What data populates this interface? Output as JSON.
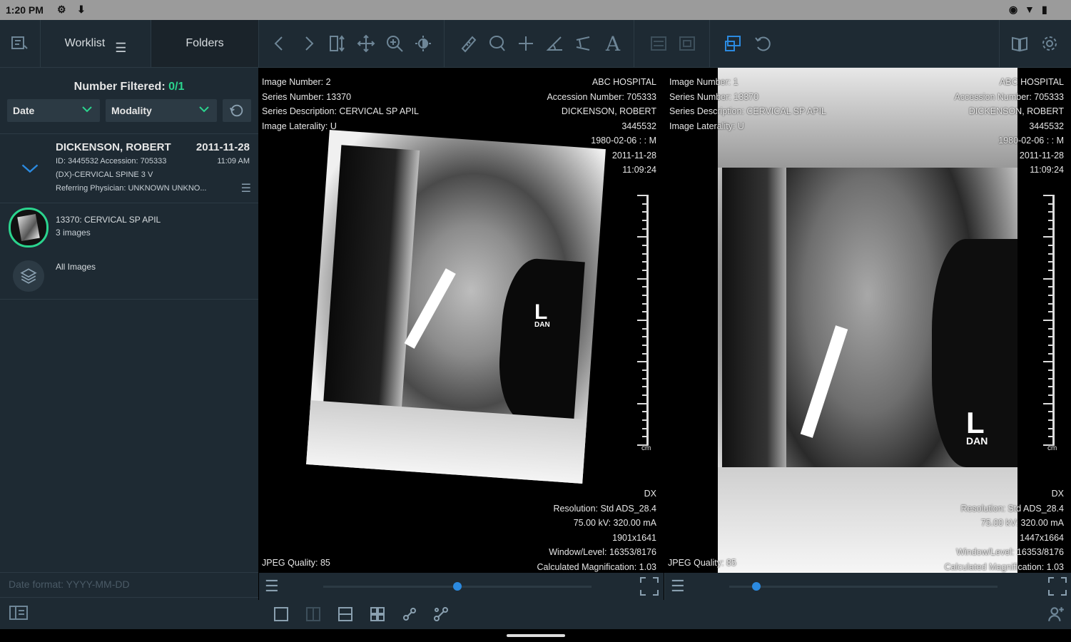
{
  "status_bar": {
    "time": "1:20 PM",
    "left_icons": [
      "gear-icon",
      "download-icon"
    ],
    "right_icons": [
      "location-icon",
      "wifi-icon",
      "battery-icon"
    ]
  },
  "toolbar": {
    "tabs": [
      {
        "label": "Worklist",
        "active": true
      },
      {
        "label": "Folders",
        "active": false
      }
    ],
    "tools": [
      "chevron-left-icon",
      "chevron-right-icon",
      "frame-scroll-icon",
      "pan-icon",
      "zoom-icon",
      "contrast-icon",
      "ruler-icon",
      "ellipse-roi-icon",
      "crosshair-icon",
      "angle-icon",
      "cobb-angle-icon",
      "text-icon",
      "annotations-off-icon",
      "key-image-icon",
      "rotate-icon",
      "refresh-icon",
      "book-icon",
      "gear-icon"
    ]
  },
  "worklist": {
    "number_filtered_label": "Number Filtered:",
    "number_filtered_value": "0/1",
    "filters": [
      {
        "label": "Date"
      },
      {
        "label": "Modality"
      }
    ],
    "patient": {
      "name": "DICKENSON, ROBERT",
      "date": "2011-11-28",
      "id_line": "ID: 3445532  Accession: 705333",
      "time": "11:09 AM",
      "study": "(DX)-CERVICAL SPINE 3 V",
      "physician": "Referring Physician: UNKNOWN UNKNO..."
    },
    "series": [
      {
        "title": "13370: CERVICAL SP APIL",
        "count": "3 images"
      },
      {
        "title": "All Images"
      }
    ],
    "date_format": "Date format: YYYY-MM-DD"
  },
  "viewports": [
    {
      "top_left": [
        "Image Number: 2",
        "Series Number: 13370",
        "Series Description: CERVICAL SP APIL",
        "Image Laterality: U"
      ],
      "top_right": [
        "ABC HOSPITAL",
        "Accession Number: 705333",
        "DICKENSON, ROBERT",
        "3445532",
        "1980-02-06 : : M",
        "2011-11-28",
        "11:09:24"
      ],
      "bottom_right": [
        "DX",
        "Resolution: Std ADS_28.4",
        "75.00 kV: 320.00 mA",
        "1901x1641",
        "Window/Level: 16353/8176",
        "Calculated Magnification: 1.03"
      ],
      "bottom_left": "JPEG Quality: 85",
      "ruler_unit": "cm",
      "slider_position": 0.5
    },
    {
      "top_left": [
        "Image Number: 1",
        "Series Number: 13370",
        "Series Description: CERVICAL SP APIL",
        "Image Laterality: U"
      ],
      "top_right": [
        "ABC HOSPITAL",
        "Accession Number: 705333",
        "DICKENSON, ROBERT",
        "3445532",
        "1980-02-06 : : M",
        "2011-11-28",
        "11:09:24"
      ],
      "bottom_right": [
        "DX",
        "Resolution: Std ADS_28.4",
        "75.00 kV: 320.00 mA",
        "1447x1664",
        "Window/Level: 16353/8176",
        "Calculated Magnification: 1.03"
      ],
      "bottom_left": "JPEG Quality: 85",
      "ruler_unit": "cm",
      "slider_position": 0.1
    }
  ],
  "xray_marker": {
    "letter": "L",
    "sub": "DAN"
  },
  "layout_buttons": [
    "layout-1x1-icon",
    "layout-1x2-icon",
    "layout-2x1-icon",
    "layout-2x2-icon",
    "link-icon",
    "link-sync-icon"
  ],
  "colors": {
    "panel": "#1e2a33",
    "accent_green": "#2bd48e",
    "accent_blue": "#2b8ae0",
    "icon": "#6e8697"
  }
}
